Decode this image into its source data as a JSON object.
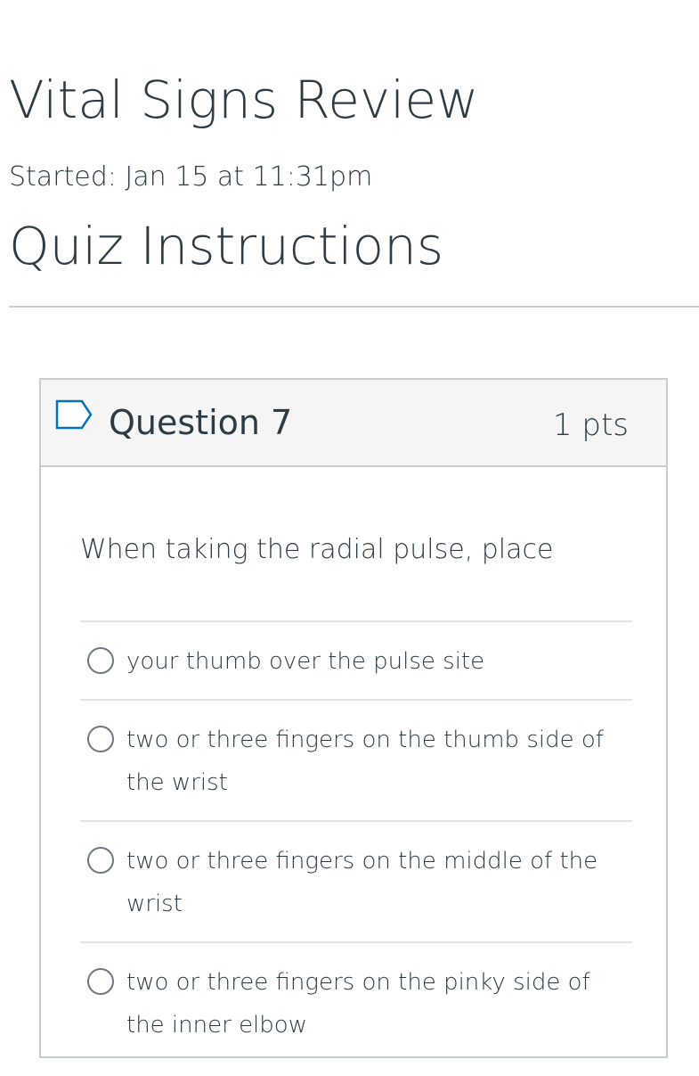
{
  "quiz": {
    "title": "Vital Signs Review",
    "started": "Started: Jan 15 at 11:31pm",
    "instructions_heading": "Quiz Instructions"
  },
  "question": {
    "name": "Question 7",
    "points": "1 pts",
    "text": "When taking the radial pulse, place",
    "answers": [
      {
        "label": "your thumb over the pulse site"
      },
      {
        "label": "two or three fingers on the thumb side of the wrist"
      },
      {
        "label": "two or three fingers on the middle of the wrist"
      },
      {
        "label": "two or three fingers on the pinky side of the inner elbow"
      }
    ]
  },
  "icons": {
    "flag": "flag-outline-icon",
    "radio": "radio-unchecked-icon"
  },
  "colors": {
    "text": "#2d3b45",
    "header_bg": "#f5f5f5",
    "border": "#c7cdd1",
    "flag_stroke": "#0374b5"
  }
}
